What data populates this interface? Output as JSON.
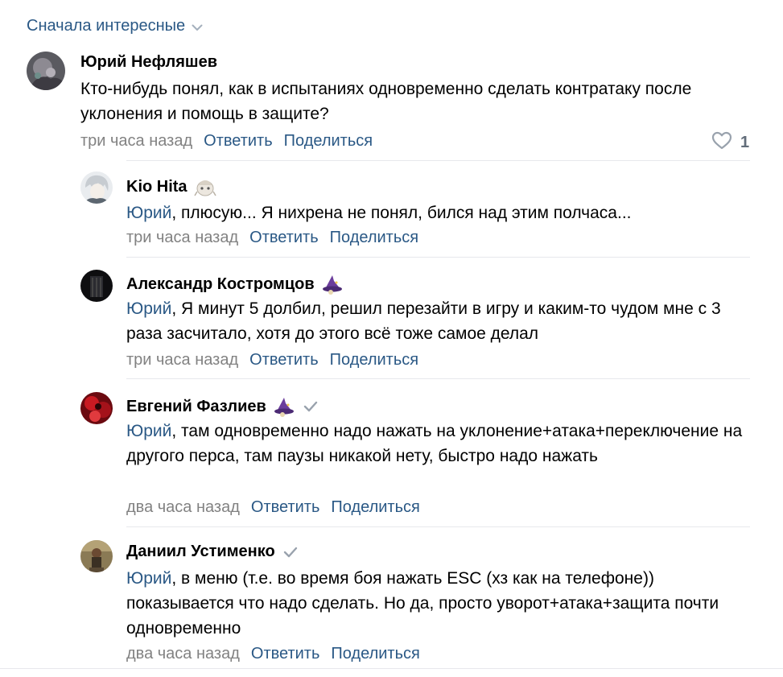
{
  "sort": {
    "label": "Сначала интересные"
  },
  "comments": [
    {
      "author": "Юрий Нефляшев",
      "text": "Кто-нибудь понял, как в испытаниях одновременно сделать контратаку после уклонения и помощь в защите?",
      "time": "три часа назад",
      "reply": "Ответить",
      "share": "Поделиться",
      "likes": "1"
    }
  ],
  "replies": [
    {
      "author": "Kio Hita",
      "reply_to": "Юрий",
      "text": ", плюсую... Я нихрена не понял, бился над этим полчаса...",
      "time": "три часа назад",
      "reply": "Ответить",
      "share": "Поделиться"
    },
    {
      "author": "Александр Костромцов",
      "reply_to": "Юрий",
      "text": ", Я минут 5 долбил, решил перезайти в игру и каким-то чудом мне с 3 раза засчитало, хотя до этого всё тоже самое делал",
      "time": "три часа назад",
      "reply": "Ответить",
      "share": "Поделиться"
    },
    {
      "author": "Евгений Фазлиев",
      "reply_to": "Юрий",
      "text": ", там одновременно надо нажать на уклонение+атака+переключение на другого перса, там паузы никакой нету, быстро надо нажать",
      "time": "два часа назад",
      "reply": "Ответить",
      "share": "Поделиться"
    },
    {
      "author": "Даниил Устименко",
      "reply_to": "Юрий",
      "text": ", в меню (т.е. во время боя нажать ESC (хз как на телефоне)) показывается что надо сделать. Но да, просто уворот+атака+защита почти одновременно",
      "time": "два часа назад",
      "reply": "Ответить",
      "share": "Поделиться"
    }
  ],
  "colors": {
    "link": "#2a5885",
    "meta": "#828282",
    "divider": "#e7e8ec"
  }
}
